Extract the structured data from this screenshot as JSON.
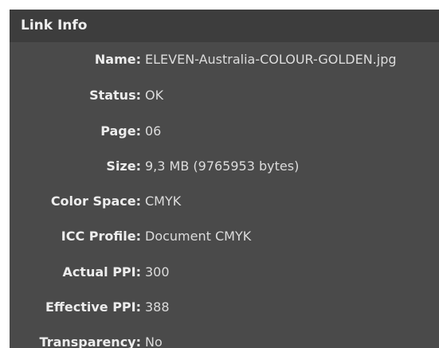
{
  "panel": {
    "title": "Link Info"
  },
  "fields": [
    {
      "label": "Name:",
      "value": "ELEVEN-Australia-COLOUR-GOLDEN.jpg"
    },
    {
      "label": "Status:",
      "value": "OK"
    },
    {
      "label": "Page:",
      "value": "06"
    },
    {
      "label": "Size:",
      "value": "9,3 MB (9765953 bytes)"
    },
    {
      "label": "Color Space:",
      "value": "CMYK"
    },
    {
      "label": "ICC Profile:",
      "value": "Document CMYK"
    },
    {
      "label": "Actual PPI:",
      "value": "300"
    },
    {
      "label": "Effective PPI:",
      "value": "388"
    },
    {
      "label": "Transparency:",
      "value": "No"
    }
  ],
  "colors": {
    "panel_bg": "#4a4a4a",
    "header_bg": "#3d3d3d",
    "text": "#ececec"
  }
}
